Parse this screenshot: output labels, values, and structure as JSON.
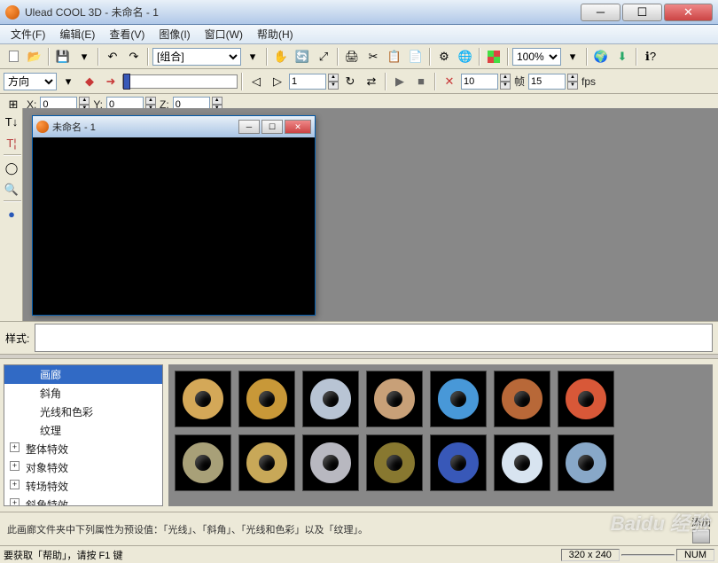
{
  "window": {
    "title": "Ulead COOL 3D - 未命名 - 1"
  },
  "menus": {
    "file": "文件(F)",
    "edit": "编辑(E)",
    "view": "查看(V)",
    "image": "图像(I)",
    "window": "窗口(W)",
    "help": "帮助(H)"
  },
  "toolbar1": {
    "combo_mode": "[组合]",
    "zoom": "100%"
  },
  "toolbar2": {
    "direction_label": "方向",
    "frame_val": "1",
    "total_frames": "10",
    "frame_unit": "帧",
    "fps": "15",
    "fps_unit": "fps"
  },
  "toolbar3": {
    "x_label": "X:",
    "x_val": "0",
    "y_label": "Y:",
    "y_val": "0",
    "z_label": "Z:",
    "z_val": "0"
  },
  "inner_window": {
    "title": "未命名 - 1"
  },
  "style_row": {
    "label": "样式:"
  },
  "tree": {
    "items": [
      {
        "label": "画廊",
        "child": true,
        "sel": true
      },
      {
        "label": "斜角",
        "child": true
      },
      {
        "label": "光线和色彩",
        "child": true
      },
      {
        "label": "纹理",
        "child": true
      },
      {
        "label": "整体特效",
        "exp": "+"
      },
      {
        "label": "对象特效",
        "exp": "+"
      },
      {
        "label": "转场特效",
        "exp": "+"
      },
      {
        "label": "斜角特效",
        "exp": "+"
      }
    ]
  },
  "thumbs": {
    "row1_colors": [
      "#d4a858",
      "#c89838",
      "#b8c4d4",
      "#c8a078",
      "#4898d8",
      "#b86838",
      "#d85838"
    ],
    "row2_colors": [
      "#a8a078",
      "#c8a858",
      "#b8b8c0",
      "#887830",
      "#3858b8",
      "#d8e4f0",
      "#88a8c8"
    ]
  },
  "info": {
    "text": "此画廊文件夹中下列属性为预设值：「光线」、「斜角」、「光线和色彩」以及「纹理」。",
    "add_label": "添加"
  },
  "statusbar": {
    "help": "要获取「帮助」，请按 F1 键",
    "dims": "320 x 240",
    "num": "NUM"
  },
  "watermark": "Baidu 经验"
}
